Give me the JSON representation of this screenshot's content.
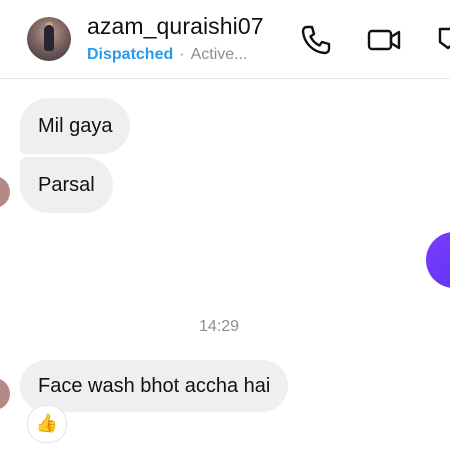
{
  "header": {
    "username": "azam_quraishi07",
    "status_label": "Dispatched",
    "status_separator": "·",
    "activity": "Active..."
  },
  "icons": {
    "call": "phone-icon",
    "video": "video-camera-icon",
    "extra": "flag-icon",
    "reaction": "thumbs-up-emoji"
  },
  "messages": [
    {
      "side": "incoming",
      "text": "Mil gaya"
    },
    {
      "side": "incoming",
      "text": "Parsal"
    }
  ],
  "timestamp": "14:29",
  "last_message": {
    "side": "incoming",
    "text": "Face wash bhot accha hai",
    "reaction": "👍"
  },
  "colors": {
    "status": "#2a9be8",
    "bubble_incoming": "#efefef",
    "outgoing_accent": "#6a38f6",
    "muted_text": "#8e8e8e"
  }
}
